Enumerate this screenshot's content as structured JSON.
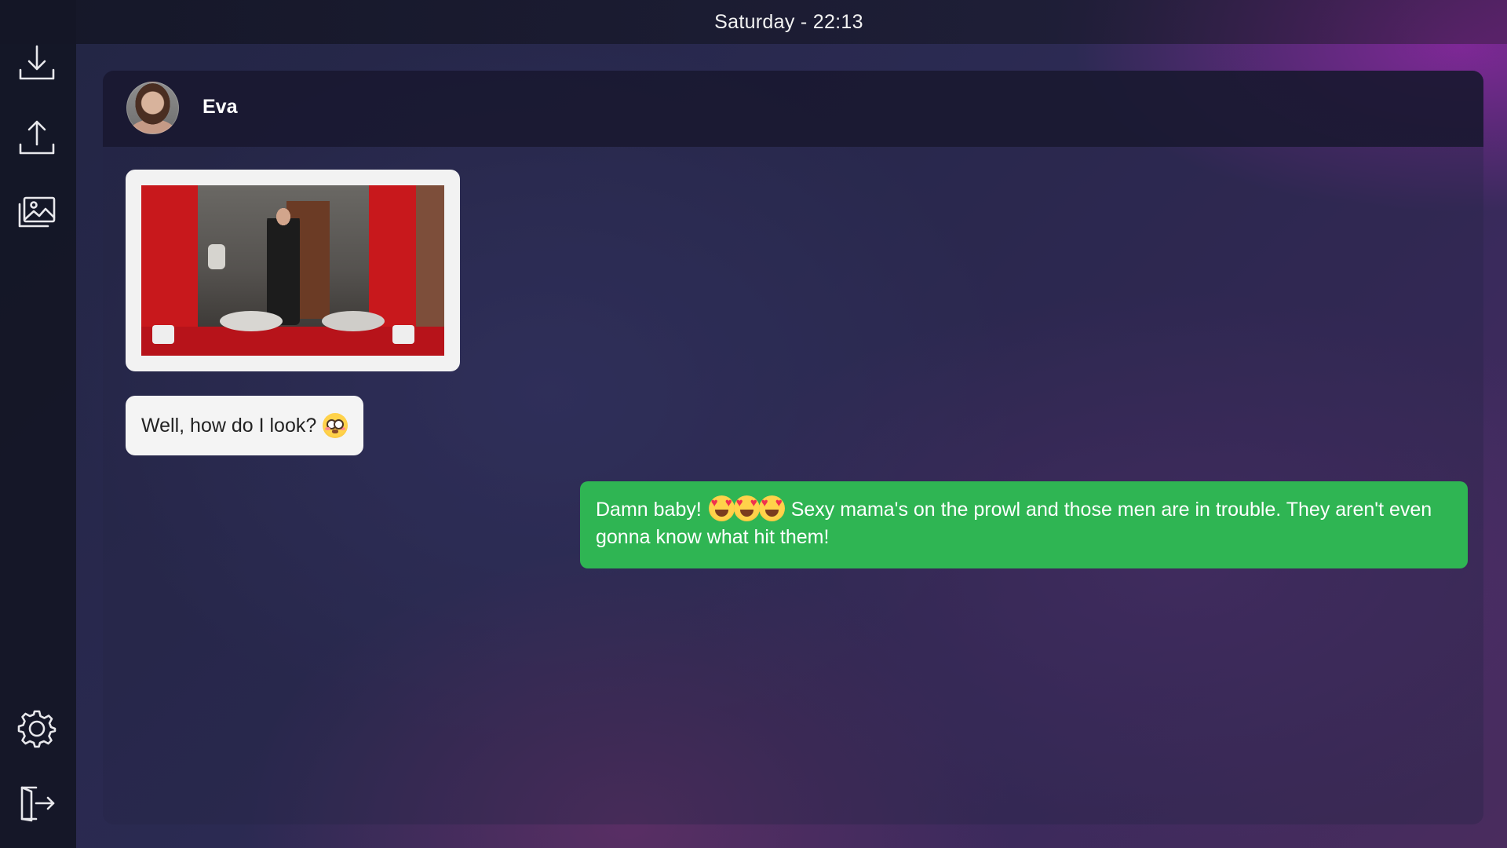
{
  "status_bar": {
    "clock": "Saturday - 22:13"
  },
  "sidebar": {
    "items": [
      {
        "icon": "download-icon",
        "label": "Download"
      },
      {
        "icon": "upload-icon",
        "label": "Upload"
      },
      {
        "icon": "gallery-icon",
        "label": "Gallery"
      },
      {
        "icon": "settings-icon",
        "label": "Settings"
      },
      {
        "icon": "exit-icon",
        "label": "Exit"
      }
    ]
  },
  "chat": {
    "contact_name": "Eva",
    "messages": [
      {
        "from": "contact",
        "type": "image"
      },
      {
        "from": "contact",
        "type": "text",
        "text": "Well, how do I look?",
        "emoji": "flushed-face"
      },
      {
        "from": "me",
        "type": "text",
        "text_before": "Damn baby!",
        "emoji": "smiling-face-with-heart-eyes",
        "emoji_count": 3,
        "text_after": "Sexy mama's on the prowl and those men are in trouble. They aren't even gonna know what hit them!"
      }
    ]
  },
  "colors": {
    "outgoing_bubble": "#2fb553",
    "incoming_bubble": "#f4f4f4",
    "sidebar": "#141626"
  }
}
